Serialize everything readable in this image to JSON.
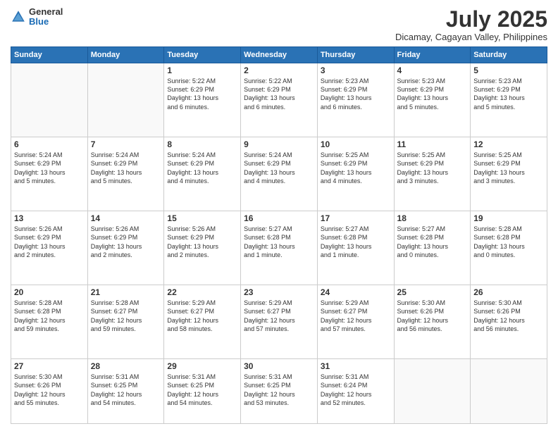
{
  "logo": {
    "general": "General",
    "blue": "Blue"
  },
  "title": "July 2025",
  "subtitle": "Dicamay, Cagayan Valley, Philippines",
  "days_header": [
    "Sunday",
    "Monday",
    "Tuesday",
    "Wednesday",
    "Thursday",
    "Friday",
    "Saturday"
  ],
  "weeks": [
    [
      {
        "day": "",
        "info": ""
      },
      {
        "day": "",
        "info": ""
      },
      {
        "day": "1",
        "info": "Sunrise: 5:22 AM\nSunset: 6:29 PM\nDaylight: 13 hours\nand 6 minutes."
      },
      {
        "day": "2",
        "info": "Sunrise: 5:22 AM\nSunset: 6:29 PM\nDaylight: 13 hours\nand 6 minutes."
      },
      {
        "day": "3",
        "info": "Sunrise: 5:23 AM\nSunset: 6:29 PM\nDaylight: 13 hours\nand 6 minutes."
      },
      {
        "day": "4",
        "info": "Sunrise: 5:23 AM\nSunset: 6:29 PM\nDaylight: 13 hours\nand 5 minutes."
      },
      {
        "day": "5",
        "info": "Sunrise: 5:23 AM\nSunset: 6:29 PM\nDaylight: 13 hours\nand 5 minutes."
      }
    ],
    [
      {
        "day": "6",
        "info": "Sunrise: 5:24 AM\nSunset: 6:29 PM\nDaylight: 13 hours\nand 5 minutes."
      },
      {
        "day": "7",
        "info": "Sunrise: 5:24 AM\nSunset: 6:29 PM\nDaylight: 13 hours\nand 5 minutes."
      },
      {
        "day": "8",
        "info": "Sunrise: 5:24 AM\nSunset: 6:29 PM\nDaylight: 13 hours\nand 4 minutes."
      },
      {
        "day": "9",
        "info": "Sunrise: 5:24 AM\nSunset: 6:29 PM\nDaylight: 13 hours\nand 4 minutes."
      },
      {
        "day": "10",
        "info": "Sunrise: 5:25 AM\nSunset: 6:29 PM\nDaylight: 13 hours\nand 4 minutes."
      },
      {
        "day": "11",
        "info": "Sunrise: 5:25 AM\nSunset: 6:29 PM\nDaylight: 13 hours\nand 3 minutes."
      },
      {
        "day": "12",
        "info": "Sunrise: 5:25 AM\nSunset: 6:29 PM\nDaylight: 13 hours\nand 3 minutes."
      }
    ],
    [
      {
        "day": "13",
        "info": "Sunrise: 5:26 AM\nSunset: 6:29 PM\nDaylight: 13 hours\nand 2 minutes."
      },
      {
        "day": "14",
        "info": "Sunrise: 5:26 AM\nSunset: 6:29 PM\nDaylight: 13 hours\nand 2 minutes."
      },
      {
        "day": "15",
        "info": "Sunrise: 5:26 AM\nSunset: 6:29 PM\nDaylight: 13 hours\nand 2 minutes."
      },
      {
        "day": "16",
        "info": "Sunrise: 5:27 AM\nSunset: 6:28 PM\nDaylight: 13 hours\nand 1 minute."
      },
      {
        "day": "17",
        "info": "Sunrise: 5:27 AM\nSunset: 6:28 PM\nDaylight: 13 hours\nand 1 minute."
      },
      {
        "day": "18",
        "info": "Sunrise: 5:27 AM\nSunset: 6:28 PM\nDaylight: 13 hours\nand 0 minutes."
      },
      {
        "day": "19",
        "info": "Sunrise: 5:28 AM\nSunset: 6:28 PM\nDaylight: 13 hours\nand 0 minutes."
      }
    ],
    [
      {
        "day": "20",
        "info": "Sunrise: 5:28 AM\nSunset: 6:28 PM\nDaylight: 12 hours\nand 59 minutes."
      },
      {
        "day": "21",
        "info": "Sunrise: 5:28 AM\nSunset: 6:27 PM\nDaylight: 12 hours\nand 59 minutes."
      },
      {
        "day": "22",
        "info": "Sunrise: 5:29 AM\nSunset: 6:27 PM\nDaylight: 12 hours\nand 58 minutes."
      },
      {
        "day": "23",
        "info": "Sunrise: 5:29 AM\nSunset: 6:27 PM\nDaylight: 12 hours\nand 57 minutes."
      },
      {
        "day": "24",
        "info": "Sunrise: 5:29 AM\nSunset: 6:27 PM\nDaylight: 12 hours\nand 57 minutes."
      },
      {
        "day": "25",
        "info": "Sunrise: 5:30 AM\nSunset: 6:26 PM\nDaylight: 12 hours\nand 56 minutes."
      },
      {
        "day": "26",
        "info": "Sunrise: 5:30 AM\nSunset: 6:26 PM\nDaylight: 12 hours\nand 56 minutes."
      }
    ],
    [
      {
        "day": "27",
        "info": "Sunrise: 5:30 AM\nSunset: 6:26 PM\nDaylight: 12 hours\nand 55 minutes."
      },
      {
        "day": "28",
        "info": "Sunrise: 5:31 AM\nSunset: 6:25 PM\nDaylight: 12 hours\nand 54 minutes."
      },
      {
        "day": "29",
        "info": "Sunrise: 5:31 AM\nSunset: 6:25 PM\nDaylight: 12 hours\nand 54 minutes."
      },
      {
        "day": "30",
        "info": "Sunrise: 5:31 AM\nSunset: 6:25 PM\nDaylight: 12 hours\nand 53 minutes."
      },
      {
        "day": "31",
        "info": "Sunrise: 5:31 AM\nSunset: 6:24 PM\nDaylight: 12 hours\nand 52 minutes."
      },
      {
        "day": "",
        "info": ""
      },
      {
        "day": "",
        "info": ""
      }
    ]
  ]
}
